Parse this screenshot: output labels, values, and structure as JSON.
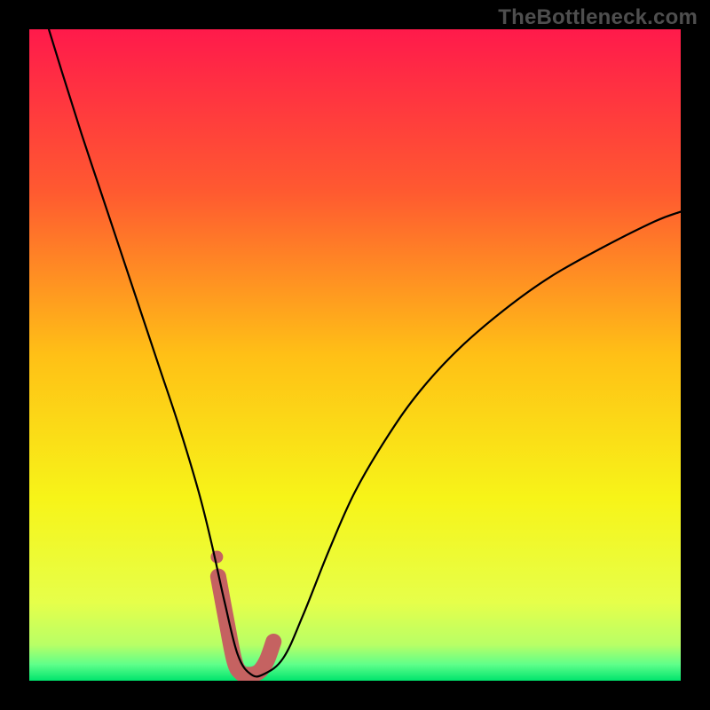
{
  "watermark": {
    "text": "TheBottleneck.com"
  },
  "chart_data": {
    "type": "line",
    "title": "",
    "xlabel": "",
    "ylabel": "",
    "xlim": [
      0,
      100
    ],
    "ylim": [
      0,
      100
    ],
    "grid": false,
    "legend": false,
    "background_gradient": {
      "stops": [
        {
          "offset": 0.0,
          "color": "#ff1a4b"
        },
        {
          "offset": 0.25,
          "color": "#ff5a30"
        },
        {
          "offset": 0.5,
          "color": "#ffc016"
        },
        {
          "offset": 0.72,
          "color": "#f7f418"
        },
        {
          "offset": 0.88,
          "color": "#e6ff4a"
        },
        {
          "offset": 0.945,
          "color": "#b8ff66"
        },
        {
          "offset": 0.975,
          "color": "#5fff8a"
        },
        {
          "offset": 1.0,
          "color": "#00e46d"
        }
      ]
    },
    "series": [
      {
        "name": "bottleneck-curve",
        "stroke": "#000000",
        "stroke_width": 2.2,
        "x": [
          3.0,
          5.0,
          8.0,
          11.0,
          14.0,
          17.0,
          20.0,
          23.0,
          26.0,
          28.0,
          30.0,
          32.0,
          34.0,
          36.0,
          39.0,
          42.0,
          46.0,
          50.0,
          55.0,
          60.0,
          66.0,
          73.0,
          80.0,
          88.0,
          96.0,
          100.0
        ],
        "values": [
          100,
          93.5,
          84.0,
          75.0,
          66.0,
          57.0,
          48.0,
          39.0,
          29.0,
          21.0,
          12.0,
          4.0,
          1.0,
          1.0,
          3.5,
          10.0,
          20.0,
          29.0,
          37.5,
          44.5,
          51.0,
          57.0,
          62.0,
          66.5,
          70.5,
          72.0
        ]
      }
    ],
    "highlight_band": {
      "name": "sweet-spot",
      "color": "#c56261",
      "segment_x": [
        29.0,
        30.3,
        31.5,
        32.5,
        33.5,
        34.5,
        35.5,
        36.5,
        37.5
      ],
      "segment_y": [
        16.0,
        9.0,
        3.0,
        1.2,
        0.9,
        1.0,
        1.6,
        3.2,
        6.0
      ],
      "stroke_width": 18,
      "outlier_dot": {
        "x": 28.8,
        "y": 19.0,
        "r": 7
      }
    }
  }
}
